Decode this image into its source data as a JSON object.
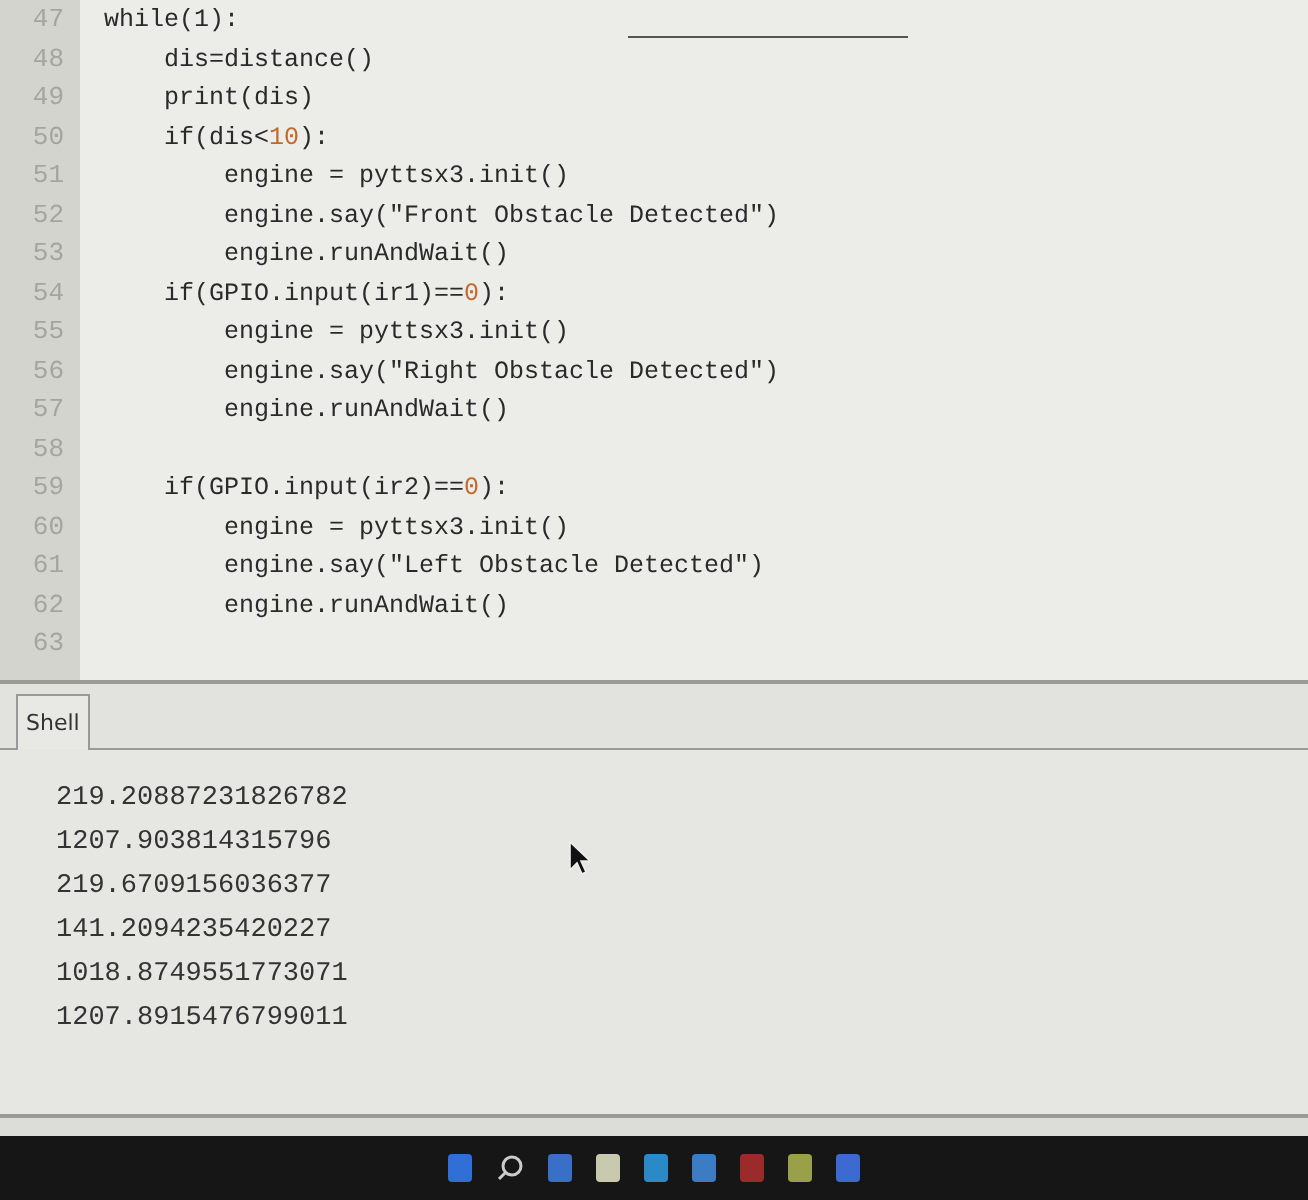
{
  "editor": {
    "lines": [
      {
        "number": "47",
        "segments": [
          {
            "text": "while(1):",
            "kind": "code"
          }
        ]
      },
      {
        "number": "48",
        "segments": [
          {
            "text": "    dis=distance()",
            "kind": "code"
          }
        ]
      },
      {
        "number": "49",
        "segments": [
          {
            "text": "    print(dis)",
            "kind": "code"
          }
        ]
      },
      {
        "number": "50",
        "segments": [
          {
            "text": "    if(dis<",
            "kind": "code"
          },
          {
            "text": "10",
            "kind": "number"
          },
          {
            "text": "):",
            "kind": "code"
          }
        ]
      },
      {
        "number": "51",
        "segments": [
          {
            "text": "        engine = pyttsx3.init()",
            "kind": "code"
          }
        ]
      },
      {
        "number": "52",
        "segments": [
          {
            "text": "        engine.say(\"Front Obstacle Detected\")",
            "kind": "code"
          }
        ]
      },
      {
        "number": "53",
        "segments": [
          {
            "text": "        engine.runAndWait()",
            "kind": "code"
          }
        ]
      },
      {
        "number": "54",
        "segments": [
          {
            "text": "    if(GPIO.input(ir1)==",
            "kind": "code"
          },
          {
            "text": "0",
            "kind": "number"
          },
          {
            "text": "):",
            "kind": "code"
          }
        ]
      },
      {
        "number": "55",
        "segments": [
          {
            "text": "        engine = pyttsx3.init()",
            "kind": "code"
          }
        ]
      },
      {
        "number": "56",
        "segments": [
          {
            "text": "        engine.say(\"Right Obstacle Detected\")",
            "kind": "code"
          }
        ]
      },
      {
        "number": "57",
        "segments": [
          {
            "text": "        engine.runAndWait()",
            "kind": "code"
          }
        ]
      },
      {
        "number": "58"
      },
      {
        "number": "59",
        "segments": [
          {
            "text": "    if(GPIO.input(ir2)==",
            "kind": "code"
          },
          {
            "text": "0",
            "kind": "number"
          },
          {
            "text": "):",
            "kind": "code"
          }
        ]
      },
      {
        "number": "60",
        "segments": [
          {
            "text": "        engine = pyttsx3.init()",
            "kind": "code"
          }
        ]
      },
      {
        "number": "61",
        "segments": [
          {
            "text": "        engine.say(\"Left Obstacle Detected\")",
            "kind": "code"
          }
        ]
      },
      {
        "number": "62",
        "segments": [
          {
            "text": "        engine.runAndWait()",
            "kind": "code"
          }
        ]
      },
      {
        "number": "63"
      }
    ]
  },
  "shell": {
    "tab": "Shell",
    "output": [
      "219.20887231826782",
      "1207.903814315796",
      "219.6709156036377",
      "141.2094235420227",
      "1018.8749551773071",
      "1207.8915476799011"
    ]
  }
}
